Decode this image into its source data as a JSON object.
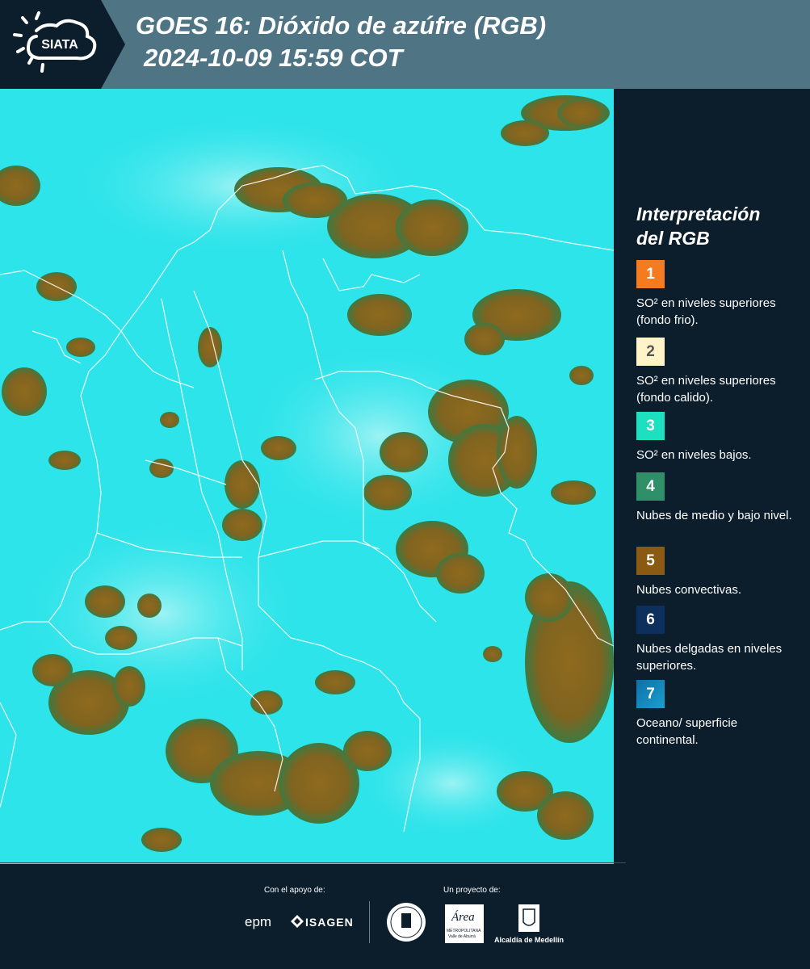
{
  "header": {
    "logo_text": "SIATA",
    "title_line1": "GOES 16: Dióxido de azúfre (RGB)",
    "title_line2": "2024-10-09 15:59 COT"
  },
  "legend": {
    "title_line1": "Interpretación",
    "title_line2": "del RGB",
    "items": [
      {
        "number": "1",
        "label": "SO² en niveles superiores (fondo frio).",
        "color": "#f47b20",
        "text_color": "#ffffff"
      },
      {
        "number": "2",
        "label": "SO² en niveles superiores (fondo calido).",
        "color": "#fff4c8",
        "text_color": "#555555"
      },
      {
        "number": "3",
        "label": "SO² en niveles bajos.",
        "color": "#1de0c0",
        "text_color": "#ffffff"
      },
      {
        "number": "4",
        "label": "Nubes de medio y bajo nivel.",
        "color": "#2e8f68",
        "text_color": "#ffffff"
      },
      {
        "number": "5",
        "label": "Nubes convectivas.",
        "color": "#8a5a12",
        "text_color": "#ffffff"
      },
      {
        "number": "6",
        "label": "Nubes delgadas en niveles superiores.",
        "color": "#0d2f5e",
        "text_color": "#ffffff"
      },
      {
        "number": "7",
        "label": "Oceano/ superficie continental.",
        "color": "#1a8fc0",
        "text_color": "#ffffff"
      }
    ]
  },
  "footer": {
    "support_label": "Con el apoyo de:",
    "project_label": "Un proyecto de:",
    "logos": {
      "epm": "epm",
      "isagen": "ISAGEN",
      "area_metropolitana": "Área",
      "area_subtitle": "METROPOLITANA",
      "area_subtitle2": "Valle de Aburrá",
      "alcaldia": "Alcaldía de Medellín",
      "medellin_seal": "MEDELLÍN"
    }
  },
  "colors": {
    "header_bg": "#4f7484",
    "page_bg": "#0c1e2b",
    "map_background": "#2de4ea",
    "cloud_brown": "#8f6a1e",
    "cloud_edge": "#3e7a42",
    "border_lines": "#ffffff"
  }
}
